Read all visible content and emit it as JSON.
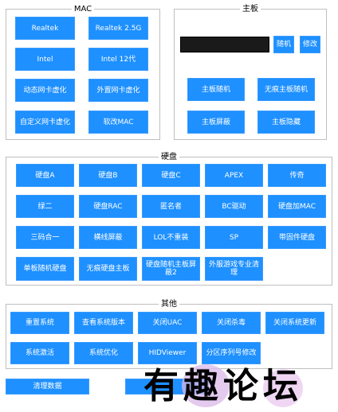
{
  "mac": {
    "title": "MAC",
    "buttons": [
      "Realtek",
      "Realtek 2.5G",
      "Intel",
      "Intel 12代",
      "动态网卡虚化",
      "外置网卡虚化",
      "自定义网卡虚化",
      "软改MAC"
    ]
  },
  "board": {
    "title": "主板",
    "random_label": "随机",
    "modify_label": "修改",
    "buttons": [
      "主板随机",
      "无痕主板随机",
      "主板屏蔽",
      "主板隐藏"
    ]
  },
  "disk": {
    "title": "硬盘",
    "buttons": [
      "硬盘A",
      "硬盘B",
      "硬盘C",
      "APEX",
      "传奇",
      "绿二",
      "硬盘RAC",
      "匿名者",
      "BC驱动",
      "硬盘加MAC",
      "三码合一",
      "横线屏蔽",
      "LOL不重装",
      "SP",
      "带固件硬盘",
      "单板随机硬盘",
      "无痕硬盘主板",
      "硬盘随机主板屏蔽2",
      "外服游戏专业清理"
    ]
  },
  "other": {
    "title": "其他",
    "buttons": [
      "重置系统",
      "查看系统版本",
      "关闭UAC",
      "关闭杀毒",
      "关闭系统更新",
      "系统激活",
      "系统优化",
      "HIDViewer",
      "分区序列号修改"
    ]
  },
  "footer": {
    "clean_label": "清理数据",
    "second_label": "",
    "watermark": "有趣论坛"
  },
  "colors": {
    "button": "#1e90ff",
    "border": "#bfbfbf",
    "display": "#1a1a1a"
  }
}
